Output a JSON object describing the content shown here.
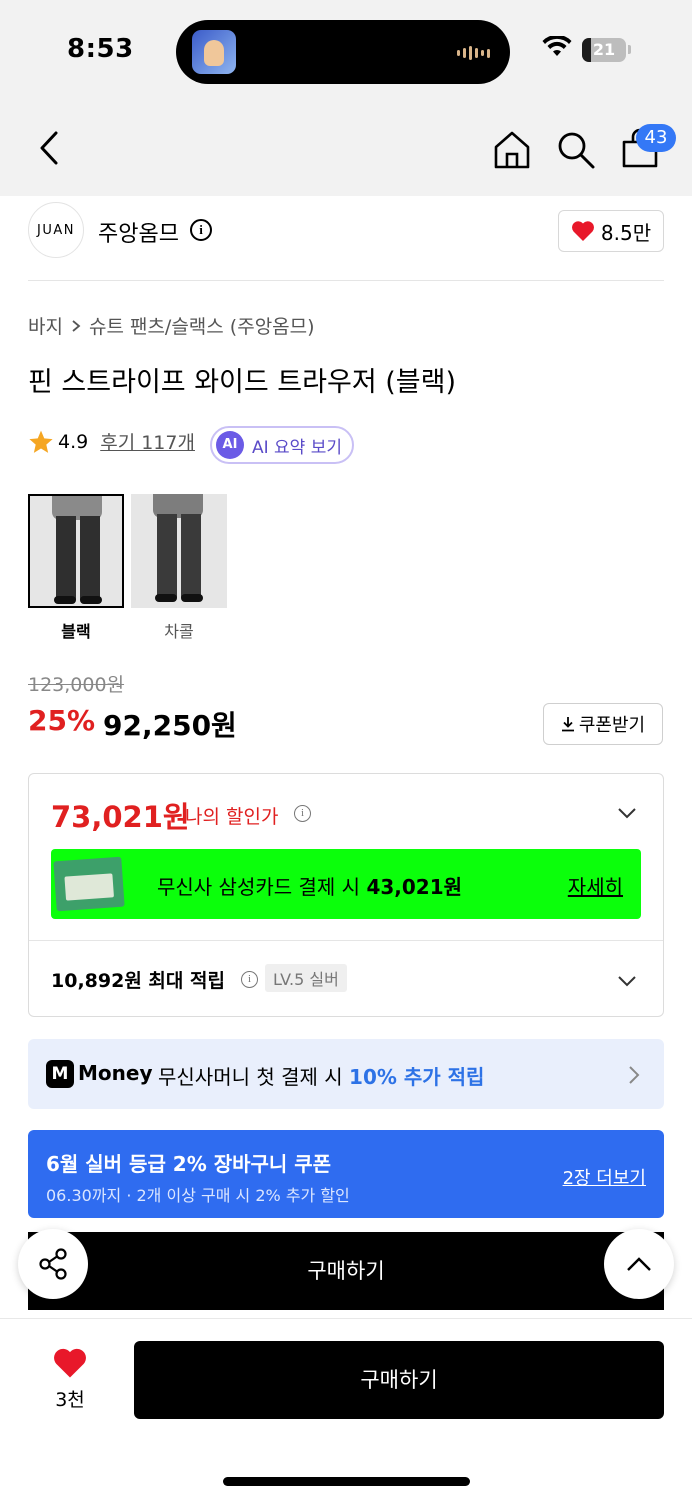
{
  "status": {
    "time": "8:53",
    "battery": "21",
    "battery_level": 0.21
  },
  "nav": {
    "cart_badge": "43"
  },
  "brand": {
    "logo_text": "JUAN",
    "name": "주앙옴므",
    "likes": "8.5만"
  },
  "product": {
    "breadcrumb": [
      "바지",
      "슈트 팬츠/슬랙스 (주앙옴므)"
    ],
    "title": "핀 스트라이프 와이드 트라우저 (블랙)",
    "rating": "4.9",
    "reviews": "후기 117개",
    "ai_badge": "AI",
    "ai_summary": "AI 요약 보기",
    "variants": [
      {
        "label": "블랙",
        "selected": true
      },
      {
        "label": "차콜",
        "selected": false
      }
    ]
  },
  "pricing": {
    "original": "123,000원",
    "discount": "25%",
    "sale": "92,250원",
    "coupon_button": "쿠폰받기",
    "my_price": "73,021원",
    "my_price_label": "나의 할인가",
    "card_text": "무신사 삼성카드 결제 시",
    "card_amount": "43,021원",
    "card_more": "자세히",
    "points": "10,892원 최대 적립",
    "level": "LV.5 실버"
  },
  "money": {
    "label": "Money",
    "text": "무신사머니 첫 결제 시",
    "highlight": "10% 추가 적립"
  },
  "coupon_banner": {
    "title": "6월 실버 등급 2% 장바구니 쿠폰",
    "subtitle": "06.30까지 · 2개 이상 구매 시 2% 추가 할인",
    "more": "2장 더보기"
  },
  "actions": {
    "buy": "구매하기",
    "wish_count": "3천"
  },
  "colors": {
    "sale_red": "#e02020",
    "card_green": "#0bff0b",
    "coupon_blue": "#2f6cf0",
    "badge_blue": "#3478f6"
  }
}
